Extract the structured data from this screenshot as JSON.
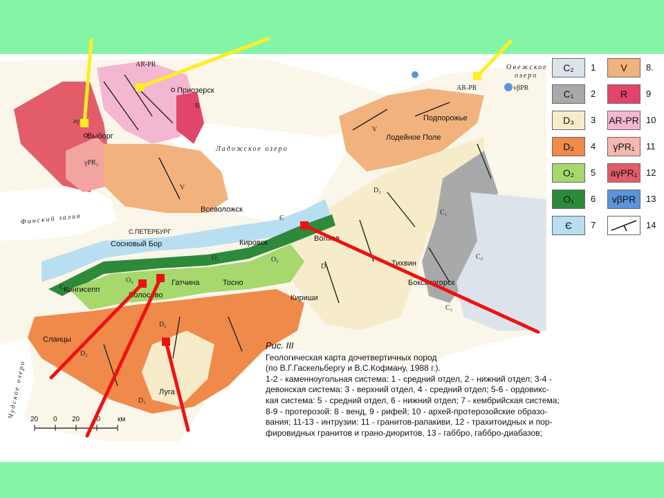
{
  "map": {
    "places": {
      "priozersk": "Приозерск",
      "vyborg": "Выборг",
      "podporozhye": "Подпорожье",
      "lodeynoe_pole": "Лодейное Поле",
      "vsevolozhsk": "Всеволожск",
      "peterburg": "С.ПЕТЕРБУРГ",
      "sosnovy_bor": "Сосновый Бор",
      "kirovsk": "Кировск",
      "volkhov": "Волхов",
      "tikhvin": "Тихвин",
      "boksitogorsk": "Бокситогорск",
      "kingisepp": "Кингисепп",
      "volosovo": "Волосово",
      "gatchina": "Гатчина",
      "tosno": "Тосно",
      "kirishi": "Кириши",
      "slantsy": "Сланцы",
      "luga": "Луга"
    },
    "water": {
      "ladoga": "Ладожское озеро",
      "onega_1": "Онежское",
      "onega_2": "озеро",
      "finsky": "Финский залив",
      "chudskoe": "Чудское озеро"
    },
    "unit_labels": {
      "ar_pr": "AR-PR",
      "ar_pr_short": "AR-PR",
      "r": "R",
      "v": "V",
      "d3": "D₃",
      "d2": "D₂",
      "o2": "O₂",
      "o1": "O₁",
      "c1": "C₁",
      "c2": "C₂",
      "cambrian": "Є",
      "ypr": "γPR₁",
      "ayp": "aγ",
      "vbpr": "vβPR"
    },
    "scale": {
      "ticks": [
        "20",
        "0",
        "20",
        "40",
        "км"
      ],
      "lengths": [
        -20,
        0,
        20,
        40
      ]
    }
  },
  "legend": [
    {
      "symbol": "C₂",
      "number": "1",
      "color": "#dde3ea"
    },
    {
      "symbol": "V",
      "number": "8.",
      "color": "#f2b27e"
    },
    {
      "symbol": "C₁",
      "number": "2",
      "color": "#a8aaaa"
    },
    {
      "symbol": "R",
      "number": "9",
      "color": "#e0456a"
    },
    {
      "symbol": "D₃",
      "number": "3",
      "color": "#f7ecc9"
    },
    {
      "symbol": "AR-PR",
      "number": "10",
      "color": "#f4b7d1"
    },
    {
      "symbol": "D₂",
      "number": "4",
      "color": "#ef8a4a"
    },
    {
      "symbol": "γPR₁",
      "number": "11",
      "color": "#f7b7b0"
    },
    {
      "symbol": "O₂",
      "number": "5",
      "color": "#a6d86e"
    },
    {
      "symbol": "aγPR₁",
      "number": "12",
      "color": "#e35c6a"
    },
    {
      "symbol": "O₁",
      "number": "6",
      "color": "#2d8a3a"
    },
    {
      "symbol": "vβPR",
      "number": "13",
      "color": "#5b94d8"
    },
    {
      "symbol": "Є",
      "number": "7",
      "color": "#b8def2"
    },
    {
      "symbol": "",
      "number": "14",
      "color": "#ffffff"
    }
  ],
  "caption": {
    "title": "Рис. III",
    "lines": [
      "Геологическая карта дочетвертичных пород",
      "(по В.Г.Гаскельбергу и В.С.Кофману, 1988 г.).",
      "1-2 - каменноугольная система: 1 - средний отдел, 2 - нижний отдел; 3-4 -",
      "девонская система: 3 - верхний отдел, 4 - средний отдел; 5-6 - ордовикс-",
      "кая система: 5 - средний отдел, 6 - нижний отдел; 7 - кембрийская система;",
      "8-9 - протерозой: 8 - венд, 9 - рифей; 10 - архей-протерозойские образо-",
      "вания; 11-13 - интрузии: 11 - гранитов-рапакиви, 12 - трахитоидных и пор-",
      "фировидных гранитов и грано-диоритов, 13 - габбро, габбро-диабазов;"
    ]
  },
  "colors": {
    "slide_background": "#84f5a6",
    "yellow_arrow": "#ffee22",
    "red_arrow": "#ee1111"
  }
}
